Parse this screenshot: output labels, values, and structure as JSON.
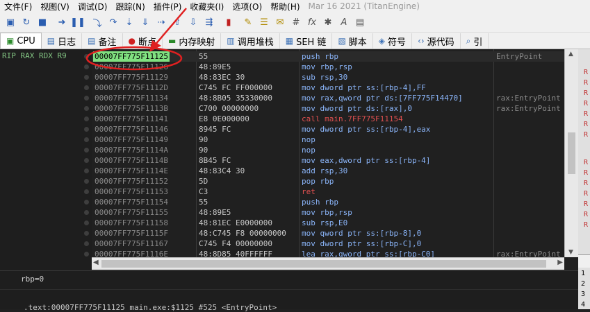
{
  "menu": {
    "items": [
      "文件(F)",
      "视图(V)",
      "调试(D)",
      "跟踪(N)",
      "插件(P)",
      "收藏夹(I)",
      "选项(O)",
      "帮助(H)"
    ],
    "date_text": "Mar 16 2021 (TitanEngine)"
  },
  "tabs": [
    {
      "label": "CPU",
      "icon": "cpu-icon"
    },
    {
      "label": "日志",
      "icon": "log-icon"
    },
    {
      "label": "备注",
      "icon": "notes-icon"
    },
    {
      "label": "断点",
      "icon": "breakpoint-icon"
    },
    {
      "label": "内存映射",
      "icon": "memory-map-icon"
    },
    {
      "label": "调用堆栈",
      "icon": "call-stack-icon"
    },
    {
      "label": "SEH 链",
      "icon": "seh-chain-icon"
    },
    {
      "label": "脚本",
      "icon": "script-icon"
    },
    {
      "label": "符号",
      "icon": "symbol-icon"
    },
    {
      "label": "源代码",
      "icon": "source-code-icon"
    },
    {
      "label": "引",
      "icon": "references-icon"
    }
  ],
  "registers_label": "RIP RAX RDX R9",
  "rows": [
    {
      "addr": "00007FF775F11125",
      "bytes": "55",
      "instr": "push rbp",
      "comment": "EntryPoint"
    },
    {
      "addr": "00007FF775F11126",
      "bytes": "48:89E5",
      "instr": "mov rbp,rsp",
      "comment": ""
    },
    {
      "addr": "00007FF775F11129",
      "bytes": "48:83EC 30",
      "instr": "sub rsp,30",
      "comment": ""
    },
    {
      "addr": "00007FF775F1112D",
      "bytes": "C745 FC FF000000",
      "instr": "mov dword ptr ss:[rbp-4],FF",
      "comment": ""
    },
    {
      "addr": "00007FF775F11134",
      "bytes": "48:8B05 35330000",
      "instr": "mov rax,qword ptr ds:[7FF775F14470]",
      "comment": "rax:EntryPoint"
    },
    {
      "addr": "00007FF775F1113B",
      "bytes": "C700 00000000",
      "instr": "mov dword ptr ds:[rax],0",
      "comment": "rax:EntryPoint"
    },
    {
      "addr": "00007FF775F11141",
      "bytes": "E8 0E000000",
      "instr": "call main.7FF775F11154",
      "comment": ""
    },
    {
      "addr": "00007FF775F11146",
      "bytes": "8945 FC",
      "instr": "mov dword ptr ss:[rbp-4],eax",
      "comment": ""
    },
    {
      "addr": "00007FF775F11149",
      "bytes": "90",
      "instr": "nop",
      "comment": ""
    },
    {
      "addr": "00007FF775F1114A",
      "bytes": "90",
      "instr": "nop",
      "comment": ""
    },
    {
      "addr": "00007FF775F1114B",
      "bytes": "8B45 FC",
      "instr": "mov eax,dword ptr ss:[rbp-4]",
      "comment": ""
    },
    {
      "addr": "00007FF775F1114E",
      "bytes": "48:83C4 30",
      "instr": "add rsp,30",
      "comment": ""
    },
    {
      "addr": "00007FF775F11152",
      "bytes": "5D",
      "instr": "pop rbp",
      "comment": ""
    },
    {
      "addr": "00007FF775F11153",
      "bytes": "C3",
      "instr": "ret",
      "comment": ""
    },
    {
      "addr": "00007FF775F11154",
      "bytes": "55",
      "instr": "push rbp",
      "comment": ""
    },
    {
      "addr": "00007FF775F11155",
      "bytes": "48:89E5",
      "instr": "mov rbp,rsp",
      "comment": ""
    },
    {
      "addr": "00007FF775F11158",
      "bytes": "48:81EC E0000000",
      "instr": "sub rsp,E0",
      "comment": ""
    },
    {
      "addr": "00007FF775F1115F",
      "bytes": "48:C745 F8 00000000",
      "instr": "mov qword ptr ss:[rbp-8],0",
      "comment": ""
    },
    {
      "addr": "00007FF775F11167",
      "bytes": "C745 F4 00000000",
      "instr": "mov dword ptr ss:[rbp-C],0",
      "comment": ""
    },
    {
      "addr": "00007FF775F1116E",
      "bytes": "48:8D85 40FFFFFF",
      "instr": "lea rax,qword ptr ss:[rbp-C0]",
      "comment": "rax:EntryPoint"
    }
  ],
  "info": {
    "line1": "rbp=0",
    "line2": ".text:00007FF775F11125 main.exe:$1125 #525 <EntryPoint>"
  },
  "colors": {
    "highlight_addr_bg": "#80e080",
    "annotation_red": "#e02020",
    "call_red": "#e05050"
  }
}
